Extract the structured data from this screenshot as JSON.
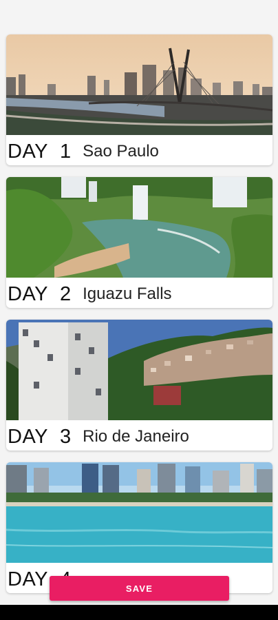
{
  "itinerary": [
    {
      "day_label": "DAY",
      "day_number": "1",
      "city": "Sao Paulo"
    },
    {
      "day_label": "DAY",
      "day_number": "2",
      "city": "Iguazu Falls"
    },
    {
      "day_label": "DAY",
      "day_number": "3",
      "city": "Rio de Janeiro"
    },
    {
      "day_label": "DAY",
      "day_number": "4",
      "city": ""
    }
  ],
  "save_button": {
    "label": "SAVE"
  },
  "colors": {
    "accent": "#e91e63",
    "nav_bar": "#000000",
    "background": "#f4f4f4"
  }
}
